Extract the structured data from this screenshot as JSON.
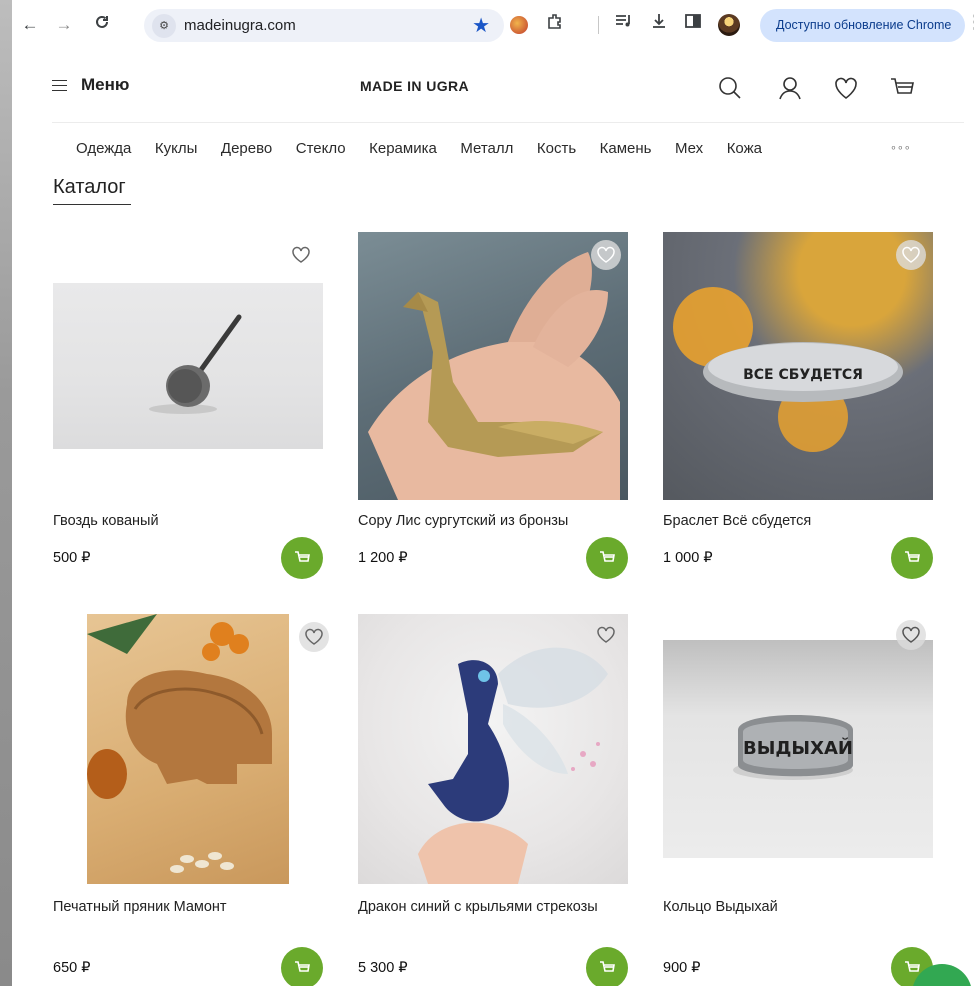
{
  "browser": {
    "url": "madeinugra.com",
    "update_label": "Доступно обновление Chrome"
  },
  "header": {
    "menu_label": "Меню",
    "logo": "MADE IN UGRA"
  },
  "categories": [
    "Одежда",
    "Куклы",
    "Дерево",
    "Стекло",
    "Керамика",
    "Металл",
    "Кость",
    "Камень",
    "Мех",
    "Кожа"
  ],
  "catalog_title": "Каталог",
  "products": [
    {
      "name": "Гвоздь кованый",
      "price": "500 ₽"
    },
    {
      "name": "Copy Лис сургутский из бронзы",
      "price": "1 200 ₽"
    },
    {
      "name": "Браслет Всё сбудется",
      "price": "1 000 ₽",
      "engraving": "ВСЕ СБУДЕТСЯ"
    },
    {
      "name": "Печатный пряник Мамонт",
      "price": "650 ₽"
    },
    {
      "name": "Дракон синий с крыльями стрекозы",
      "price": "5 300 ₽"
    },
    {
      "name": "Кольцо Выдыхай",
      "price": "900 ₽",
      "engraving": "ВЫДЫХАЙ"
    }
  ],
  "colors": {
    "cart_green": "#6aaa2c",
    "omnibox_bg": "#eef1f8",
    "update_pill": "#d3e3fd",
    "bookmark_star": "#1a56c7"
  }
}
